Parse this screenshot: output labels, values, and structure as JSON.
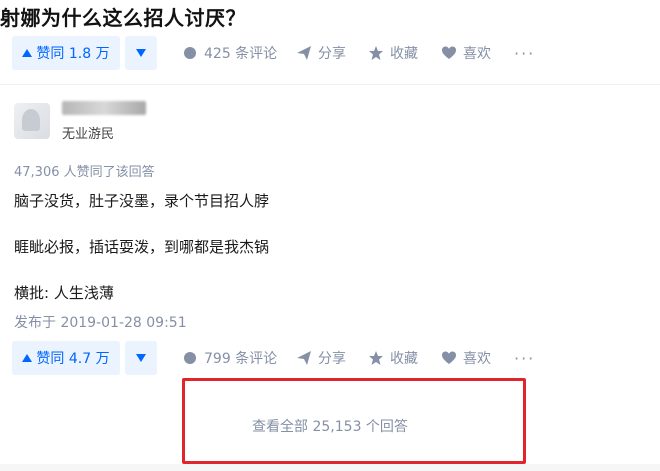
{
  "question": {
    "title": "射娜为什么这么招人讨厌？"
  },
  "top_actions": {
    "vote_label": "赞同 1.8 万",
    "comments": "425 条评论",
    "share": "分享",
    "favorite": "收藏",
    "like": "喜欢",
    "more": "···"
  },
  "answer": {
    "author_headline": "无业游民",
    "votes_summary": "47,306 人赞同了该回答",
    "paragraphs": [
      "脑子没货，肚子没墨，录个节目招人脖",
      "睚眦必报，插话耍泼，到哪都是我杰锅",
      "横批: 人生浅薄"
    ],
    "published": "发布于 2019-01-28 09:51"
  },
  "bottom_actions": {
    "vote_label": "赞同 4.7 万",
    "comments": "799 条评论",
    "share": "分享",
    "favorite": "收藏",
    "like": "喜欢",
    "more": "···"
  },
  "view_all": {
    "label": "查看全部 25,153 个回答"
  },
  "colors": {
    "accent": "#0066ff",
    "muted": "#8590a6",
    "highlight": "#e0262c"
  }
}
